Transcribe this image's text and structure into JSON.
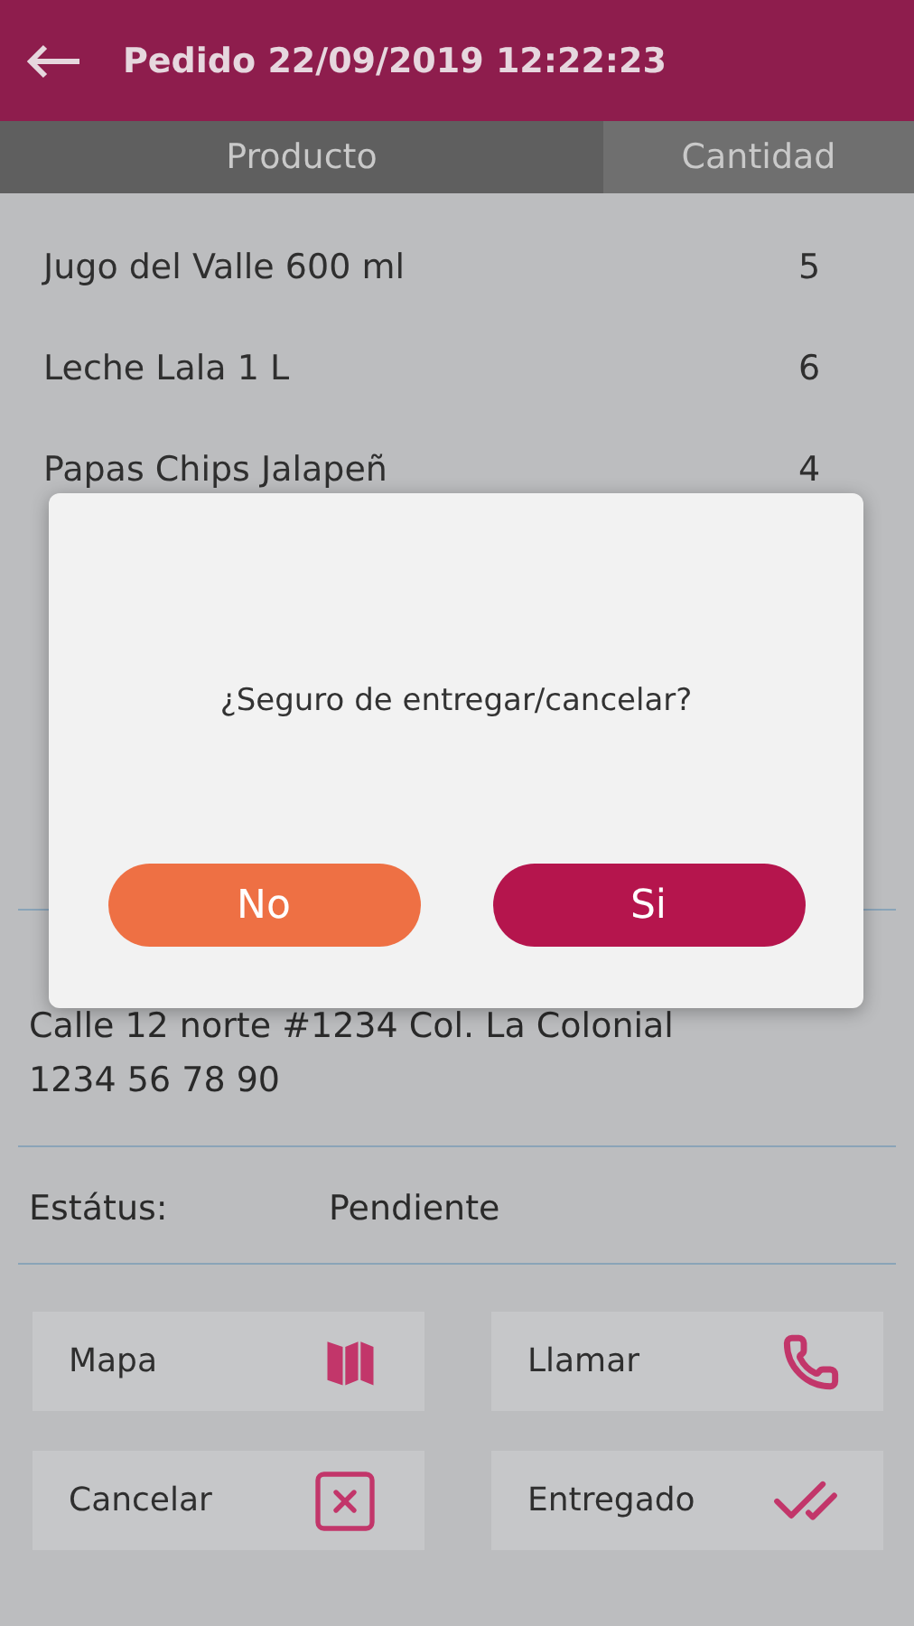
{
  "header": {
    "title": "Pedido 22/09/2019 12:22:23"
  },
  "table": {
    "columns": [
      "Producto",
      "Cantidad"
    ],
    "rows": [
      {
        "product": "Jugo del Valle 600 ml",
        "quantity": "5"
      },
      {
        "product": "Leche Lala 1 L",
        "quantity": "6"
      },
      {
        "product": "Papas Chips Jalapeñ",
        "quantity": "4"
      }
    ]
  },
  "address": {
    "lines": [
      "Calle 12 norte #1234 Col. La Colonial",
      "1234 56 78 90"
    ]
  },
  "status": {
    "label": "Estátus:",
    "value": "Pendiente"
  },
  "actions": [
    {
      "label": "Mapa"
    },
    {
      "label": "Llamar"
    },
    {
      "label": "Cancelar"
    },
    {
      "label": "Entregado"
    }
  ],
  "dialog": {
    "message": "¿Seguro de entregar/cancelar?",
    "buttons": [
      {
        "label": "No",
        "kind": "secondary"
      },
      {
        "label": "Si",
        "kind": "primary"
      }
    ]
  }
}
